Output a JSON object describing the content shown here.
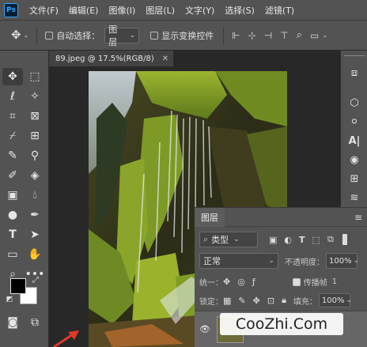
{
  "app": {
    "logo": "Ps"
  },
  "menubar": {
    "items": [
      "文件(F)",
      "编辑(E)",
      "图像(I)",
      "图层(L)",
      "文字(Y)",
      "选择(S)",
      "滤镜(T)"
    ]
  },
  "options": {
    "auto_select_label": "自动选择：",
    "layer_dropdown": "图层",
    "show_transform_label": "显示变换控件"
  },
  "document": {
    "tab_title": "89.jpeg @ 17.5%(RGB/8)"
  },
  "layers_panel": {
    "title": "图层",
    "filter_kind": "类型",
    "blend_mode": "正常",
    "opacity_label": "不透明度：",
    "opacity_value": "100%",
    "unify_label": "统一：",
    "propagate_label": "传播帧",
    "propagate_value": "1",
    "lock_label": "锁定：",
    "fill_label": "填充：",
    "fill_value": "100%"
  },
  "watermark": {
    "text": "CooZhi.Com"
  },
  "colors": {
    "accent": "#31a8ff",
    "panel": "#535353",
    "canvas_bg": "#282828",
    "arrow": "#e03a2c"
  }
}
